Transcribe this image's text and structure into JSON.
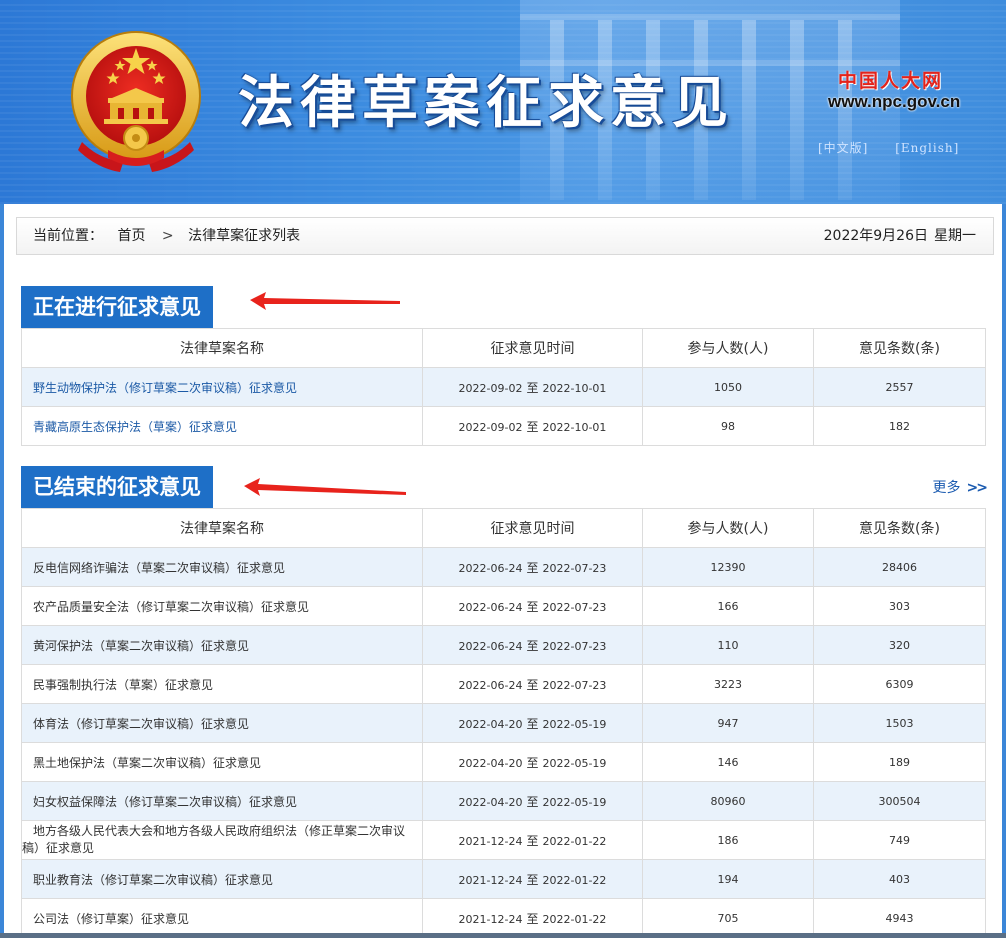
{
  "header": {
    "site_title": "法律草案征求意见",
    "npc_logo_text": "中国人大网",
    "npc_url": "www.npc.gov.cn",
    "lang_links": [
      {
        "label": "[中文版]"
      },
      {
        "label": "[English]"
      }
    ]
  },
  "breadcrumb": {
    "prefix": "当前位置：",
    "home": "首页",
    "separator": ">",
    "current": "法律草案征求列表",
    "date": "2022年9月26日",
    "weekday": "星期一"
  },
  "ongoing": {
    "title": "正在进行征求意见",
    "columns": [
      "法律草案名称",
      "征求意见时间",
      "参与人数(人)",
      "意见条数(条)"
    ],
    "rows": [
      {
        "name": "野生动物保护法（修订草案二次审议稿）征求意见",
        "start": "2022-09-02",
        "to": "至",
        "end": "2022-10-01",
        "participants": "1050",
        "comments": "2557"
      },
      {
        "name": "青藏高原生态保护法（草案）征求意见",
        "start": "2022-09-02",
        "to": "至",
        "end": "2022-10-01",
        "participants": "98",
        "comments": "182"
      }
    ]
  },
  "ended": {
    "title": "已结束的征求意见",
    "more_label": "更多",
    "more_icon": "double-chevron-right",
    "columns": [
      "法律草案名称",
      "征求意见时间",
      "参与人数(人)",
      "意见条数(条)"
    ],
    "rows": [
      {
        "name": "反电信网络诈骗法（草案二次审议稿）征求意见",
        "start": "2022-06-24",
        "to": "至",
        "end": "2022-07-23",
        "participants": "12390",
        "comments": "28406"
      },
      {
        "name": "农产品质量安全法（修订草案二次审议稿）征求意见",
        "start": "2022-06-24",
        "to": "至",
        "end": "2022-07-23",
        "participants": "166",
        "comments": "303"
      },
      {
        "name": "黄河保护法（草案二次审议稿）征求意见",
        "start": "2022-06-24",
        "to": "至",
        "end": "2022-07-23",
        "participants": "110",
        "comments": "320"
      },
      {
        "name": "民事强制执行法（草案）征求意见",
        "start": "2022-06-24",
        "to": "至",
        "end": "2022-07-23",
        "participants": "3223",
        "comments": "6309"
      },
      {
        "name": "体育法（修订草案二次审议稿）征求意见",
        "start": "2022-04-20",
        "to": "至",
        "end": "2022-05-19",
        "participants": "947",
        "comments": "1503"
      },
      {
        "name": "黑土地保护法（草案二次审议稿）征求意见",
        "start": "2022-04-20",
        "to": "至",
        "end": "2022-05-19",
        "participants": "146",
        "comments": "189"
      },
      {
        "name": "妇女权益保障法（修订草案二次审议稿）征求意见",
        "start": "2022-04-20",
        "to": "至",
        "end": "2022-05-19",
        "participants": "80960",
        "comments": "300504"
      },
      {
        "name": "地方各级人民代表大会和地方各级人民政府组织法（修正草案二次审议稿）征求意见",
        "start": "2021-12-24",
        "to": "至",
        "end": "2022-01-22",
        "participants": "186",
        "comments": "749"
      },
      {
        "name": "职业教育法（修订草案二次审议稿）征求意见",
        "start": "2021-12-24",
        "to": "至",
        "end": "2022-01-22",
        "participants": "194",
        "comments": "403"
      },
      {
        "name": "公司法（修订草案）征求意见",
        "start": "2021-12-24",
        "to": "至",
        "end": "2022-01-22",
        "participants": "705",
        "comments": "4943"
      }
    ]
  },
  "colors": {
    "banner_blue": "#3b86d8",
    "section_blue": "#1e6fc7",
    "row_stripe": "#e9f2fb",
    "link_blue": "#1c5aa6",
    "annotation_red": "#e8231c",
    "emblem_red": "#d71d1d",
    "emblem_gold": "#f2c12e"
  }
}
